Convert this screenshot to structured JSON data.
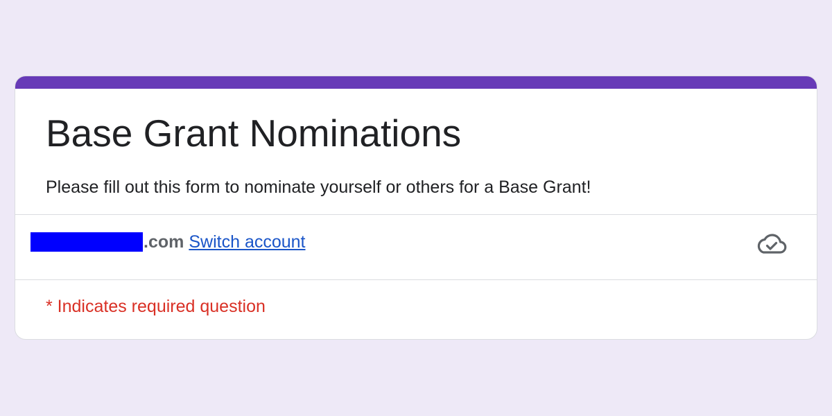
{
  "colors": {
    "background": "#eee9f7",
    "accent": "#673ab7",
    "redaction": "#0000ff",
    "link": "#1a55c8",
    "required": "#d93025",
    "icon": "#5f6368"
  },
  "form": {
    "title": "Base Grant Nominations",
    "description": "Please fill out this form to nominate yourself or others for a Base Grant!"
  },
  "account": {
    "email_suffix": ".com",
    "switch_label": "Switch account",
    "status_icon": "cloud-check-icon"
  },
  "required_note": "* Indicates required question"
}
